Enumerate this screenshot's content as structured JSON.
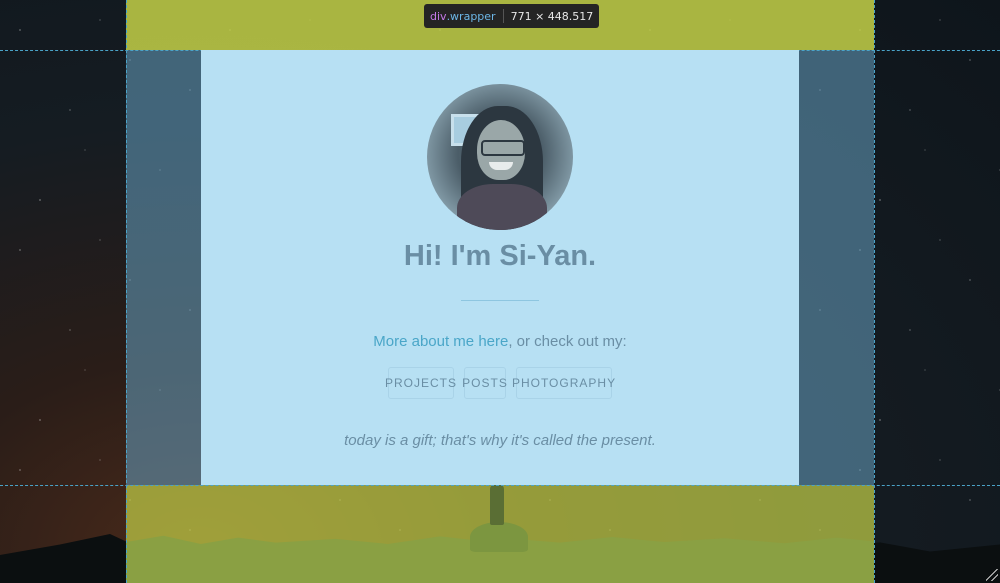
{
  "devtools": {
    "element_tag": "div",
    "element_class": ".wrapper",
    "dimensions": "771 × 448.517"
  },
  "profile": {
    "avatar_alt": "Si-Yan portrait",
    "heading": "Hi! I'm Si-Yan.",
    "intro_link": "More about me here",
    "intro_rest": ", or check out my:",
    "quote": "today is a gift; that's why it's called the present."
  },
  "nav_buttons": [
    {
      "label": "PROJECTS"
    },
    {
      "label": "POSTS"
    },
    {
      "label": "PHOTOGRAPHY"
    }
  ],
  "colors": {
    "content_background": "#b7e0f3",
    "margin_highlight": "#c4d148",
    "padding_highlight": "#67a2c2",
    "link": "#4aa6c8",
    "text": "#6a8ea4"
  }
}
